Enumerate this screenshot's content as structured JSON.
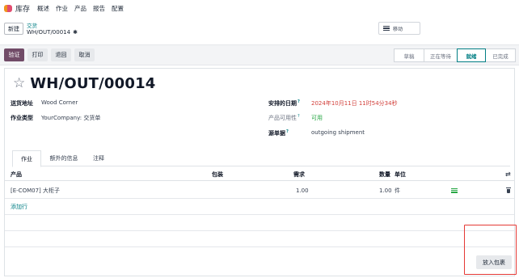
{
  "topnav": {
    "app_name": "库存",
    "menu": [
      "概述",
      "作业",
      "产品",
      "报告",
      "配置"
    ]
  },
  "breadcrumb": {
    "new_label": "新建",
    "parent": "交货",
    "current": "WH/OUT/00014",
    "gear_icon": "gear-icon"
  },
  "move_button": {
    "label": "移动",
    "icon": "hamburger-icon"
  },
  "actions": {
    "validate": "验证",
    "print": "打印",
    "return": "退回",
    "cancel": "取消"
  },
  "status": {
    "stages": [
      "草稿",
      "正在等待",
      "就绪",
      "已完成"
    ],
    "active": "就绪"
  },
  "record": {
    "title": "WH/OUT/00014",
    "star_icon": "star-icon"
  },
  "fields": {
    "delivery_address_label": "送货地址",
    "delivery_address": "Wood Corner",
    "operation_type_label": "作业类型",
    "operation_type": "YourCompany: 交货单",
    "scheduled_date_label": "安排的日期",
    "scheduled_date": "2024年10月11日 11时54分34秒",
    "availability_label": "产品可用性",
    "availability": "可用",
    "source_doc_label": "源单据",
    "source_doc": "outgoing shipment",
    "help_mark": "?"
  },
  "tabs": [
    "作业",
    "额外的信息",
    "注释"
  ],
  "table": {
    "headers": {
      "product": "产品",
      "package": "包装",
      "demand": "需求",
      "quantity": "数量",
      "unit": "单位"
    },
    "rows": [
      {
        "product": "[E-COM07] 大柜子",
        "demand": "1.00",
        "quantity": "1.00",
        "unit": "件"
      }
    ],
    "add_line": "添加行"
  },
  "put_in_pack": "放入包裹",
  "colors": {
    "primary": "#714b67",
    "link": "#017e84",
    "danger": "#d23f3a",
    "success": "#28a745",
    "highlight": "#e53935"
  }
}
